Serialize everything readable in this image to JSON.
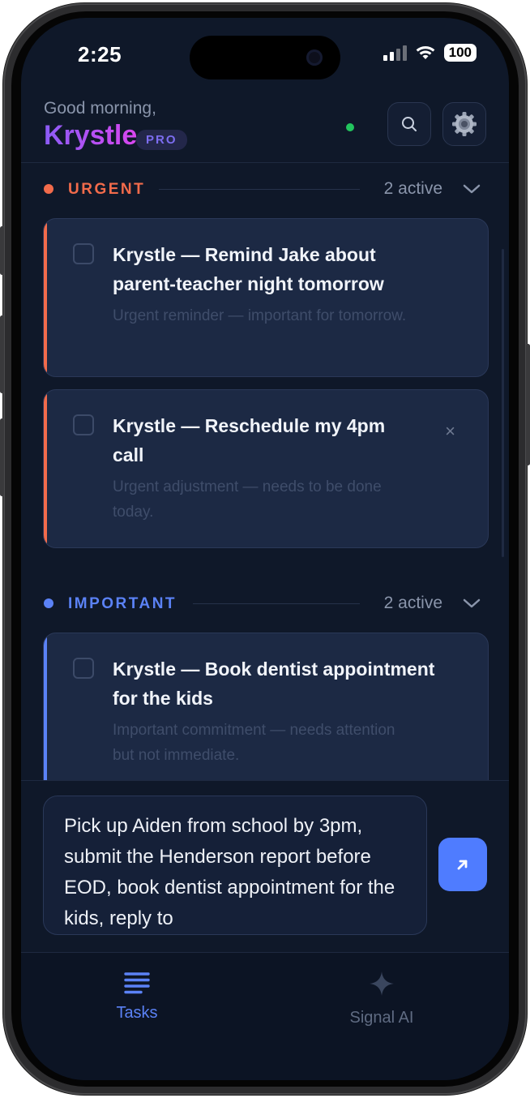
{
  "status": {
    "time": "2:25",
    "battery": "100"
  },
  "header": {
    "greeting": "Good morning,",
    "name": "Krystle",
    "badge": "PRO"
  },
  "sections": [
    {
      "title": "URGENT",
      "count": "2 active",
      "color": "#f26b4b",
      "tasks": [
        {
          "title": "Krystle — Remind Jake about parent-teacher night tomorrow",
          "subtitle": "Urgent reminder — important for tomorrow."
        },
        {
          "title": "Krystle — Reschedule my 4pm call",
          "subtitle": "Urgent adjustment — needs to be done today.",
          "dismiss": "×"
        }
      ]
    },
    {
      "title": "IMPORTANT",
      "count": "2 active",
      "color": "#5b82f6",
      "tasks": [
        {
          "title": "Krystle — Book dentist appointment for the kids",
          "subtitle": "Important commitment — needs attention but not immediate."
        }
      ]
    }
  ],
  "composer": {
    "text": "Pick up Aiden from school by 3pm, submit the Henderson report before EOD, book dentist appointment for the kids, reply to"
  },
  "tabs": [
    {
      "label": "Tasks",
      "icon": "list-icon",
      "active": true
    },
    {
      "label": "Signal AI",
      "icon": "sparkle-icon",
      "active": false
    }
  ],
  "colors": {
    "accent": "#4f7cff",
    "brand_gradient_start": "#8b5cf6",
    "brand_gradient_end": "#d946ef",
    "online": "#22c55e"
  }
}
